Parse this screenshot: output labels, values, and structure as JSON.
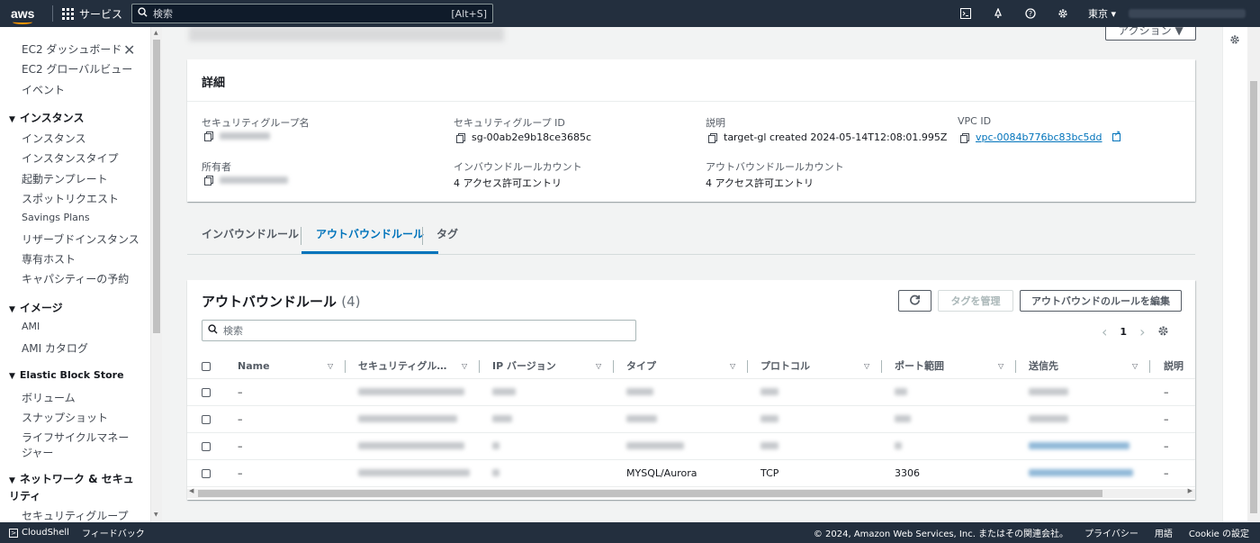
{
  "topnav": {
    "logo": "aws",
    "services": "サービス",
    "search_placeholder": "検索",
    "search_shortcut": "[Alt+S]",
    "region": "東京 ▾",
    "icons": [
      "cloudshell-icon",
      "bell-icon",
      "help-icon",
      "gear-icon"
    ]
  },
  "sidebar": {
    "items_top": [
      "EC2 ダッシュボード",
      "EC2 グローバルビュー",
      "イベント"
    ],
    "sections": [
      {
        "title": "インスタンス",
        "items": [
          "インスタンス",
          "インスタンスタイプ",
          "起動テンプレート",
          "スポットリクエスト",
          "Savings Plans",
          "リザーブドインスタンス",
          "専有ホスト",
          "キャパシティーの予約"
        ]
      },
      {
        "title": "イメージ",
        "items": [
          "AMI",
          "AMI カタログ"
        ]
      },
      {
        "title": "Elastic Block Store",
        "items": [
          "ボリューム",
          "スナップショット",
          "ライフサイクルマネージャー"
        ]
      },
      {
        "title": "ネットワーク & セキュリティ",
        "items": [
          "セキュリティグループ"
        ]
      }
    ]
  },
  "header": {
    "actions_button": "アクション ▼"
  },
  "details": {
    "title": "詳細",
    "fields": {
      "sg_name_label": "セキュリティグループ名",
      "sg_id_label": "セキュリティグループ ID",
      "sg_id": "sg-00ab2e9b18ce3685c",
      "desc_label": "説明",
      "desc": "target-gl created 2024-05-14T12:08:01.995Z",
      "vpc_label": "VPC ID",
      "vpc": "vpc-0084b776bc83bc5dd",
      "owner_label": "所有者",
      "inbound_count_label": "インバウンドルールカウント",
      "inbound_count": "4 アクセス許可エントリ",
      "outbound_count_label": "アウトバウンドルールカウント",
      "outbound_count": "4 アクセス許可エントリ"
    }
  },
  "tabs": [
    "インバウンドルール",
    "アウトバウンドルール",
    "タグ"
  ],
  "active_tab": "アウトバウンドルール",
  "rules": {
    "title": "アウトバウンドルール",
    "count": "(4)",
    "manage_tags": "タグを管理",
    "edit_rules": "アウトバウンドのルールを編集",
    "filter_placeholder": "検索",
    "page": "1",
    "columns": [
      "Name",
      "セキュリティグル…",
      "IP バージョン",
      "タイプ",
      "プロトコル",
      "ポート範囲",
      "送信先",
      "説明"
    ],
    "rows": [
      {
        "name": "–",
        "desc": "–"
      },
      {
        "name": "–",
        "desc": "–"
      },
      {
        "name": "–",
        "desc": "–"
      },
      {
        "name": "–",
        "type": "MYSQL/Aurora",
        "protocol": "TCP",
        "port": "3306",
        "desc": "–"
      }
    ]
  },
  "footer": {
    "cloudshell": "CloudShell",
    "feedback": "フィードバック",
    "copyright": "© 2024, Amazon Web Services, Inc. またはその関連会社。",
    "privacy": "プライバシー",
    "terms": "用語",
    "cookie": "Cookie の設定"
  }
}
